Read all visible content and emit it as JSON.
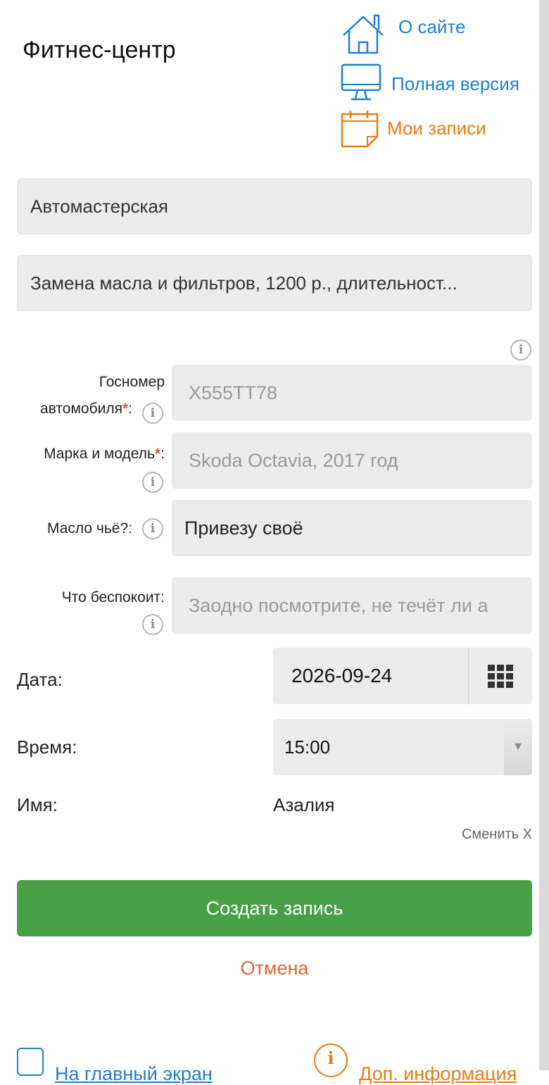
{
  "header": {
    "title": "Фитнес-центр",
    "links": {
      "about": {
        "label": "О сайте",
        "icon": "home-icon"
      },
      "full_version": {
        "label": "Полная версия",
        "icon": "monitor-icon"
      },
      "my_bookings": {
        "label": "Мои записи",
        "icon": "calendar-icon"
      }
    }
  },
  "service_category": {
    "value": "Автомастерская"
  },
  "service": {
    "value": "Замена масла и фильтров, 1200 р., длительност..."
  },
  "fields": {
    "plate": {
      "label_line1": "Госномер",
      "label_line2": "автомобиля",
      "required_mark": "*",
      "colon": ":",
      "placeholder": "Х555ТТ78"
    },
    "model": {
      "label": "Марка и модель",
      "required_mark": "*",
      "colon": ":",
      "placeholder": "Skoda Octavia, 2017 год"
    },
    "oil": {
      "label": "Масло чьё?:",
      "value": "Привезу своё"
    },
    "concern": {
      "label": "Что беспокоит:",
      "placeholder": "Заодно посмотрите, не течёт ли а"
    }
  },
  "date": {
    "label": "Дата:",
    "value": "2026-09-24"
  },
  "time": {
    "label": "Время:",
    "value": "15:00"
  },
  "name": {
    "label": "Имя:",
    "value": "Азалия",
    "change_label": "Сменить Х"
  },
  "actions": {
    "submit": "Создать запись",
    "cancel": "Отмена"
  },
  "footer": {
    "home": "На главный экран",
    "info": "Доп. информация"
  },
  "colors": {
    "link_blue": "#1e7fd6",
    "link_orange": "#ec7a12",
    "submit_green": "#47a046",
    "cancel_red": "#e0673a"
  }
}
